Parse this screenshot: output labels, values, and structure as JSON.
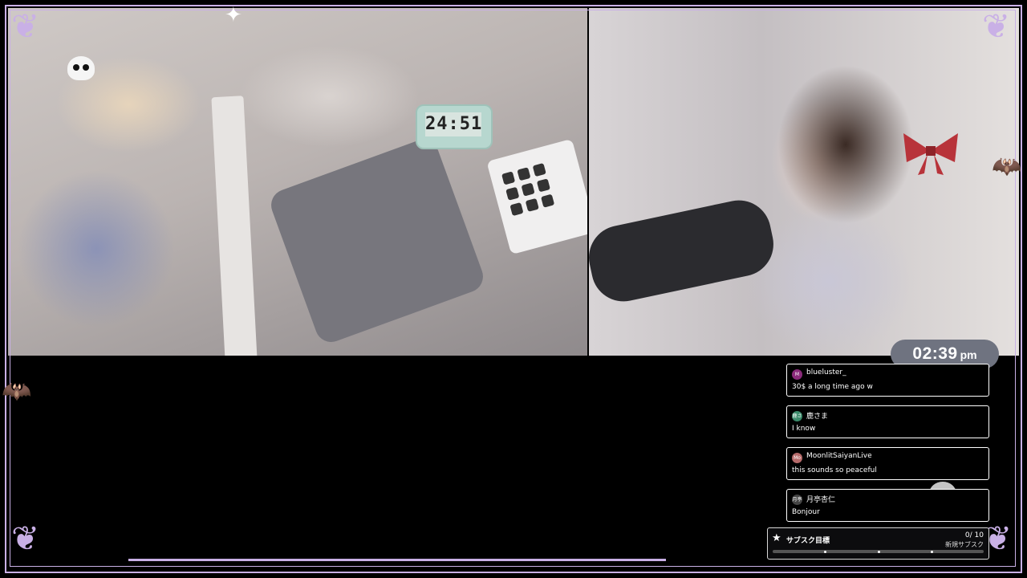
{
  "stream": {
    "desk_timer_display": "24:51"
  },
  "clock": {
    "time": "02:39",
    "ampm": "pm"
  },
  "chat": {
    "messages": [
      {
        "avatar_text": "M",
        "avatar_color": "#8a2a7a",
        "user": "blueluster_",
        "text": "30$ a long time ago w"
      },
      {
        "avatar_text": "鹿さ",
        "avatar_color": "#3a8a6a",
        "user": "鹿さま",
        "text": "I know"
      },
      {
        "avatar_text": "Mo",
        "avatar_color": "#b56a6a",
        "user": "MoonlitSaiyanLive",
        "text": "this sounds so peaceful"
      },
      {
        "avatar_text": "月亭",
        "avatar_color": "#444444",
        "user": "月亭杏仁",
        "text": "Bonjour"
      }
    ]
  },
  "sub_goal": {
    "label": "サブスク目標",
    "count": "0/ 10",
    "subtitle": "新規サブスク",
    "progress": 0.0
  },
  "colors": {
    "frame": "#c9b0e6",
    "clock_bg": "#6f7380"
  },
  "icons": {
    "goal": "star-icon",
    "decor": [
      "skull-icon",
      "bat-icon",
      "sparkle-icon"
    ]
  }
}
